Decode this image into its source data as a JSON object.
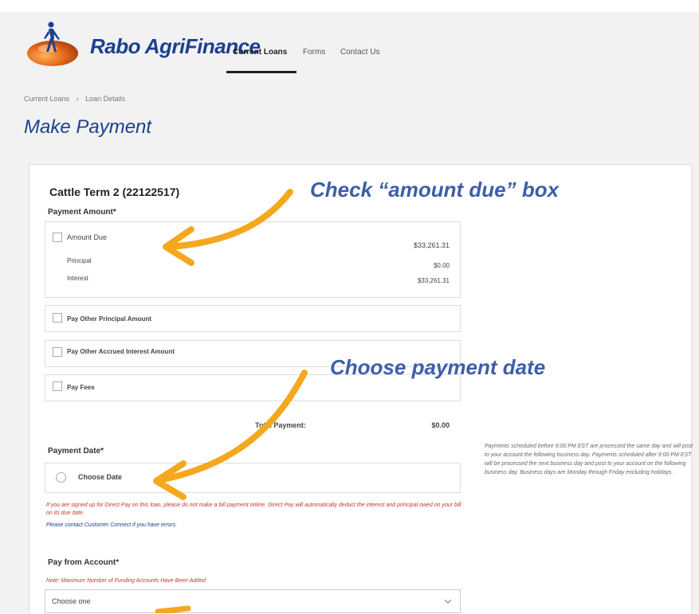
{
  "header": {
    "brand": "Rabo AgriFinance",
    "nav": [
      "Current Loans",
      "Forms",
      "Contact Us"
    ]
  },
  "breadcrumb": [
    "Current Loans",
    "›",
    "Loan Details"
  ],
  "page_title": "Make Payment",
  "loan": {
    "title": "Cattle Term 2 (22122517)",
    "payment_amount_label": "Payment Amount*",
    "amount_due": {
      "label": "Amount Due",
      "value": "$33,261.31"
    },
    "principal": {
      "label": "Principal",
      "value": "$0.00"
    },
    "interest": {
      "label": "Interest",
      "value": "$33,261.31"
    },
    "options": [
      "Pay Other Principal Amount",
      "Pay Other Accrued Interest Amount",
      "Pay Fees"
    ],
    "total_label": "Total Payment:",
    "total_value": "$0.00",
    "payment_date_label": "Payment Date*",
    "choose_date": "Choose Date",
    "direct_pay_note": "If you are signed up for Direct Pay on this loan, please do not make a bill payment online. Direct Pay will automatically deduct the interest and principal owed on your bill on its due date.",
    "contact_note": "Please contact Customer Connect if you have errors.",
    "side_note": "Payments scheduled before 9:00 PM EST are processed the same day and will post to your account the following business day. Payments scheduled after 9:00 PM EST will be processed the next business day and post to your account on the following business day. Business days are Monday through Friday excluding holidays.",
    "pay_from_label": "Pay from Account*",
    "max_accounts_note": "Note: Maximum Number of Funding Accounts Have Been Added",
    "select_value": "Choose one"
  },
  "annotations": {
    "check_box": "Check “amount due” box",
    "choose_date": "Choose payment date"
  },
  "colors": {
    "brand_blue": "#1d3f8f",
    "arrow_orange": "#f4a81d",
    "annotation_blue": "#3e5ea8",
    "note_red": "#c0392b"
  }
}
